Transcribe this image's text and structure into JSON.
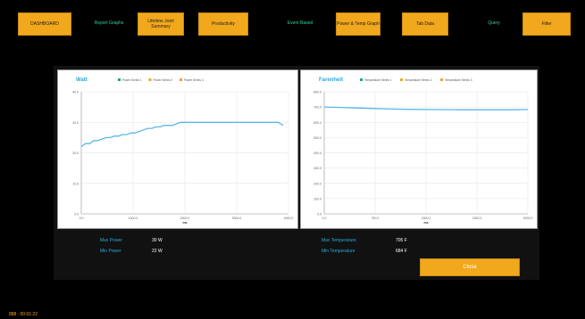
{
  "nav": [
    {
      "label": "DASHBOARD",
      "style": "box"
    },
    {
      "label": "Report Graphs",
      "style": "plain"
    },
    {
      "label": "Lifetime Joint Summary",
      "style": "box"
    },
    {
      "label": "Productivity",
      "style": "box"
    },
    {
      "label": "Event Based",
      "style": "plain"
    },
    {
      "label": "Power & Temp Graph",
      "style": "box"
    },
    {
      "label": "Tab Data",
      "style": "box"
    },
    {
      "label": "Query",
      "style": "plain"
    },
    {
      "label": "Filter",
      "style": "box"
    }
  ],
  "charts": {
    "power": {
      "title": "Watt",
      "legend": [
        "Power Series 1",
        "Power Series 2",
        "Power Series 3"
      ],
      "xlabel": "ms"
    },
    "temp": {
      "title": "Farenheit",
      "legend": [
        "Temperature Series 1",
        "Temperature Series 2",
        "Temperature Series 3"
      ],
      "xlabel": "ms"
    }
  },
  "chart_data": [
    {
      "type": "line",
      "title": "Watt",
      "xlabel": "ms",
      "ylabel": "",
      "xlim": [
        0,
        4000
      ],
      "ylim": [
        0,
        40
      ],
      "xticks": [
        "0.0",
        "1000.0",
        "2000.0",
        "3000.0",
        "4000.0"
      ],
      "yticks": [
        "0.0",
        "10.0",
        "20.0",
        "30.0",
        "40.0"
      ],
      "legend_position": "top",
      "grid": true,
      "series": [
        {
          "name": "Power Series 1",
          "color": "#5ab8e6",
          "x": [
            0,
            80,
            160,
            240,
            320,
            400,
            480,
            560,
            640,
            720,
            800,
            880,
            960,
            1040,
            1120,
            1200,
            1280,
            1360,
            1440,
            1520,
            1600,
            1680,
            1760,
            1840,
            1920,
            2000,
            2400,
            2800,
            3200,
            3600,
            3800,
            3900
          ],
          "y": [
            22,
            23,
            23,
            24,
            24,
            24.5,
            25,
            25,
            25.5,
            25.5,
            26,
            26,
            26.5,
            26.5,
            27,
            27.5,
            28,
            28,
            28.5,
            28.5,
            29,
            29,
            29,
            29.5,
            30,
            30,
            30,
            30,
            30,
            30,
            30,
            29
          ]
        }
      ]
    },
    {
      "type": "line",
      "title": "Farenheit",
      "xlabel": "ms",
      "ylabel": "",
      "xlim": [
        0,
        3000
      ],
      "ylim": [
        0,
        800
      ],
      "xticks": [
        "0.0",
        "750.0",
        "1500.0",
        "2250.0",
        "3000.0"
      ],
      "yticks": [
        "0.0",
        "100.0",
        "200.0",
        "300.0",
        "400.0",
        "500.0",
        "600.0",
        "700.0",
        "800.0"
      ],
      "legend_position": "top",
      "grid": true,
      "series": [
        {
          "name": "Temperature Series 1",
          "color": "#5ab8e6",
          "x": [
            0,
            250,
            500,
            750,
            1000,
            1250,
            1500,
            1750,
            2000,
            2250,
            2500,
            2750,
            3000
          ],
          "y": [
            700,
            697,
            694,
            690,
            687,
            685,
            684,
            683,
            682,
            682,
            682,
            682,
            684
          ]
        }
      ]
    }
  ],
  "stats": {
    "max_power_label": "Max Power",
    "max_power_value": "30 W",
    "min_power_label": "Min Power",
    "min_power_value": "22 W",
    "max_temp_label": "Max Temperature",
    "max_temp_value": "705 F",
    "min_temp_label": "Min Temperature",
    "min_temp_value": "684 F"
  },
  "close_label": "Close",
  "footer_text": "888 : 00:01:22",
  "colors": {
    "accent": "#f2a81d",
    "teal": "#2fd3a0",
    "line": "#5ab8e6",
    "legend1": "#27a86b",
    "legend2": "#f2a81d",
    "legend3": "#e8a23a"
  }
}
